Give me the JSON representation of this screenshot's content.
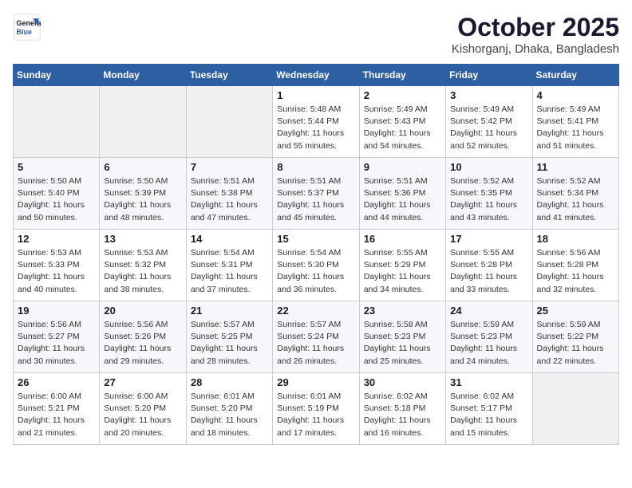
{
  "logo": {
    "line1": "General",
    "line2": "Blue"
  },
  "header": {
    "month": "October 2025",
    "location": "Kishorganj, Dhaka, Bangladesh"
  },
  "days_of_week": [
    "Sunday",
    "Monday",
    "Tuesday",
    "Wednesday",
    "Thursday",
    "Friday",
    "Saturday"
  ],
  "weeks": [
    [
      {
        "day": "",
        "info": ""
      },
      {
        "day": "",
        "info": ""
      },
      {
        "day": "",
        "info": ""
      },
      {
        "day": "1",
        "info": "Sunrise: 5:48 AM\nSunset: 5:44 PM\nDaylight: 11 hours\nand 55 minutes."
      },
      {
        "day": "2",
        "info": "Sunrise: 5:49 AM\nSunset: 5:43 PM\nDaylight: 11 hours\nand 54 minutes."
      },
      {
        "day": "3",
        "info": "Sunrise: 5:49 AM\nSunset: 5:42 PM\nDaylight: 11 hours\nand 52 minutes."
      },
      {
        "day": "4",
        "info": "Sunrise: 5:49 AM\nSunset: 5:41 PM\nDaylight: 11 hours\nand 51 minutes."
      }
    ],
    [
      {
        "day": "5",
        "info": "Sunrise: 5:50 AM\nSunset: 5:40 PM\nDaylight: 11 hours\nand 50 minutes."
      },
      {
        "day": "6",
        "info": "Sunrise: 5:50 AM\nSunset: 5:39 PM\nDaylight: 11 hours\nand 48 minutes."
      },
      {
        "day": "7",
        "info": "Sunrise: 5:51 AM\nSunset: 5:38 PM\nDaylight: 11 hours\nand 47 minutes."
      },
      {
        "day": "8",
        "info": "Sunrise: 5:51 AM\nSunset: 5:37 PM\nDaylight: 11 hours\nand 45 minutes."
      },
      {
        "day": "9",
        "info": "Sunrise: 5:51 AM\nSunset: 5:36 PM\nDaylight: 11 hours\nand 44 minutes."
      },
      {
        "day": "10",
        "info": "Sunrise: 5:52 AM\nSunset: 5:35 PM\nDaylight: 11 hours\nand 43 minutes."
      },
      {
        "day": "11",
        "info": "Sunrise: 5:52 AM\nSunset: 5:34 PM\nDaylight: 11 hours\nand 41 minutes."
      }
    ],
    [
      {
        "day": "12",
        "info": "Sunrise: 5:53 AM\nSunset: 5:33 PM\nDaylight: 11 hours\nand 40 minutes."
      },
      {
        "day": "13",
        "info": "Sunrise: 5:53 AM\nSunset: 5:32 PM\nDaylight: 11 hours\nand 38 minutes."
      },
      {
        "day": "14",
        "info": "Sunrise: 5:54 AM\nSunset: 5:31 PM\nDaylight: 11 hours\nand 37 minutes."
      },
      {
        "day": "15",
        "info": "Sunrise: 5:54 AM\nSunset: 5:30 PM\nDaylight: 11 hours\nand 36 minutes."
      },
      {
        "day": "16",
        "info": "Sunrise: 5:55 AM\nSunset: 5:29 PM\nDaylight: 11 hours\nand 34 minutes."
      },
      {
        "day": "17",
        "info": "Sunrise: 5:55 AM\nSunset: 5:28 PM\nDaylight: 11 hours\nand 33 minutes."
      },
      {
        "day": "18",
        "info": "Sunrise: 5:56 AM\nSunset: 5:28 PM\nDaylight: 11 hours\nand 32 minutes."
      }
    ],
    [
      {
        "day": "19",
        "info": "Sunrise: 5:56 AM\nSunset: 5:27 PM\nDaylight: 11 hours\nand 30 minutes."
      },
      {
        "day": "20",
        "info": "Sunrise: 5:56 AM\nSunset: 5:26 PM\nDaylight: 11 hours\nand 29 minutes."
      },
      {
        "day": "21",
        "info": "Sunrise: 5:57 AM\nSunset: 5:25 PM\nDaylight: 11 hours\nand 28 minutes."
      },
      {
        "day": "22",
        "info": "Sunrise: 5:57 AM\nSunset: 5:24 PM\nDaylight: 11 hours\nand 26 minutes."
      },
      {
        "day": "23",
        "info": "Sunrise: 5:58 AM\nSunset: 5:23 PM\nDaylight: 11 hours\nand 25 minutes."
      },
      {
        "day": "24",
        "info": "Sunrise: 5:59 AM\nSunset: 5:23 PM\nDaylight: 11 hours\nand 24 minutes."
      },
      {
        "day": "25",
        "info": "Sunrise: 5:59 AM\nSunset: 5:22 PM\nDaylight: 11 hours\nand 22 minutes."
      }
    ],
    [
      {
        "day": "26",
        "info": "Sunrise: 6:00 AM\nSunset: 5:21 PM\nDaylight: 11 hours\nand 21 minutes."
      },
      {
        "day": "27",
        "info": "Sunrise: 6:00 AM\nSunset: 5:20 PM\nDaylight: 11 hours\nand 20 minutes."
      },
      {
        "day": "28",
        "info": "Sunrise: 6:01 AM\nSunset: 5:20 PM\nDaylight: 11 hours\nand 18 minutes."
      },
      {
        "day": "29",
        "info": "Sunrise: 6:01 AM\nSunset: 5:19 PM\nDaylight: 11 hours\nand 17 minutes."
      },
      {
        "day": "30",
        "info": "Sunrise: 6:02 AM\nSunset: 5:18 PM\nDaylight: 11 hours\nand 16 minutes."
      },
      {
        "day": "31",
        "info": "Sunrise: 6:02 AM\nSunset: 5:17 PM\nDaylight: 11 hours\nand 15 minutes."
      },
      {
        "day": "",
        "info": ""
      }
    ]
  ]
}
